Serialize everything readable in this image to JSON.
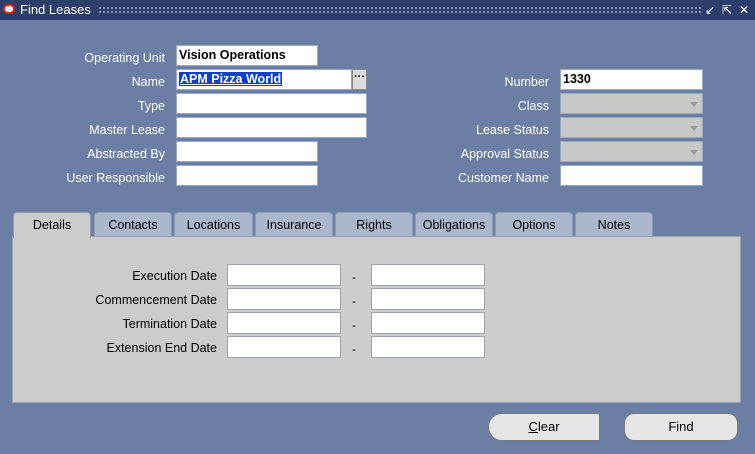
{
  "window": {
    "title": "Find Leases",
    "controls": {
      "minimize": "↙",
      "maximize": "⇱",
      "close": "✕"
    }
  },
  "form": {
    "operating_unit": {
      "label": "Operating Unit",
      "value": "Vision Operations"
    },
    "name": {
      "label": "Name",
      "value": "APM Pizza World",
      "lov": "···"
    },
    "type": {
      "label": "Type",
      "value": ""
    },
    "master_lease": {
      "label": "Master Lease",
      "value": ""
    },
    "abstracted_by": {
      "label": "Abstracted By",
      "value": ""
    },
    "user_responsible": {
      "label": "User Responsible",
      "value": ""
    },
    "number": {
      "label": "Number",
      "value": "1330"
    },
    "class": {
      "label": "Class",
      "value": ""
    },
    "lease_status": {
      "label": "Lease Status",
      "value": ""
    },
    "approval_status": {
      "label": "Approval Status",
      "value": ""
    },
    "customer_name": {
      "label": "Customer Name",
      "value": ""
    }
  },
  "tabs": [
    {
      "label": "Details",
      "active": true
    },
    {
      "label": "Contacts"
    },
    {
      "label": "Locations"
    },
    {
      "label": "Insurance"
    },
    {
      "label": "Rights"
    },
    {
      "label": "Obligations"
    },
    {
      "label": "Options"
    },
    {
      "label": "Notes"
    }
  ],
  "details": {
    "rows": [
      {
        "label": "Execution Date",
        "from": "",
        "to": ""
      },
      {
        "label": "Commencement Date",
        "from": "",
        "to": ""
      },
      {
        "label": "Termination Date",
        "from": "",
        "to": ""
      },
      {
        "label": "Extension End Date",
        "from": "",
        "to": ""
      }
    ],
    "separator": "-"
  },
  "buttons": {
    "clear_mnemonic": "C",
    "clear_rest": "lear",
    "find": "Find"
  },
  "colors": {
    "background": "#6a7fa3",
    "titlebar": "#2c3e6a",
    "panel": "#cccccc",
    "selection": "#0b3fd0"
  }
}
